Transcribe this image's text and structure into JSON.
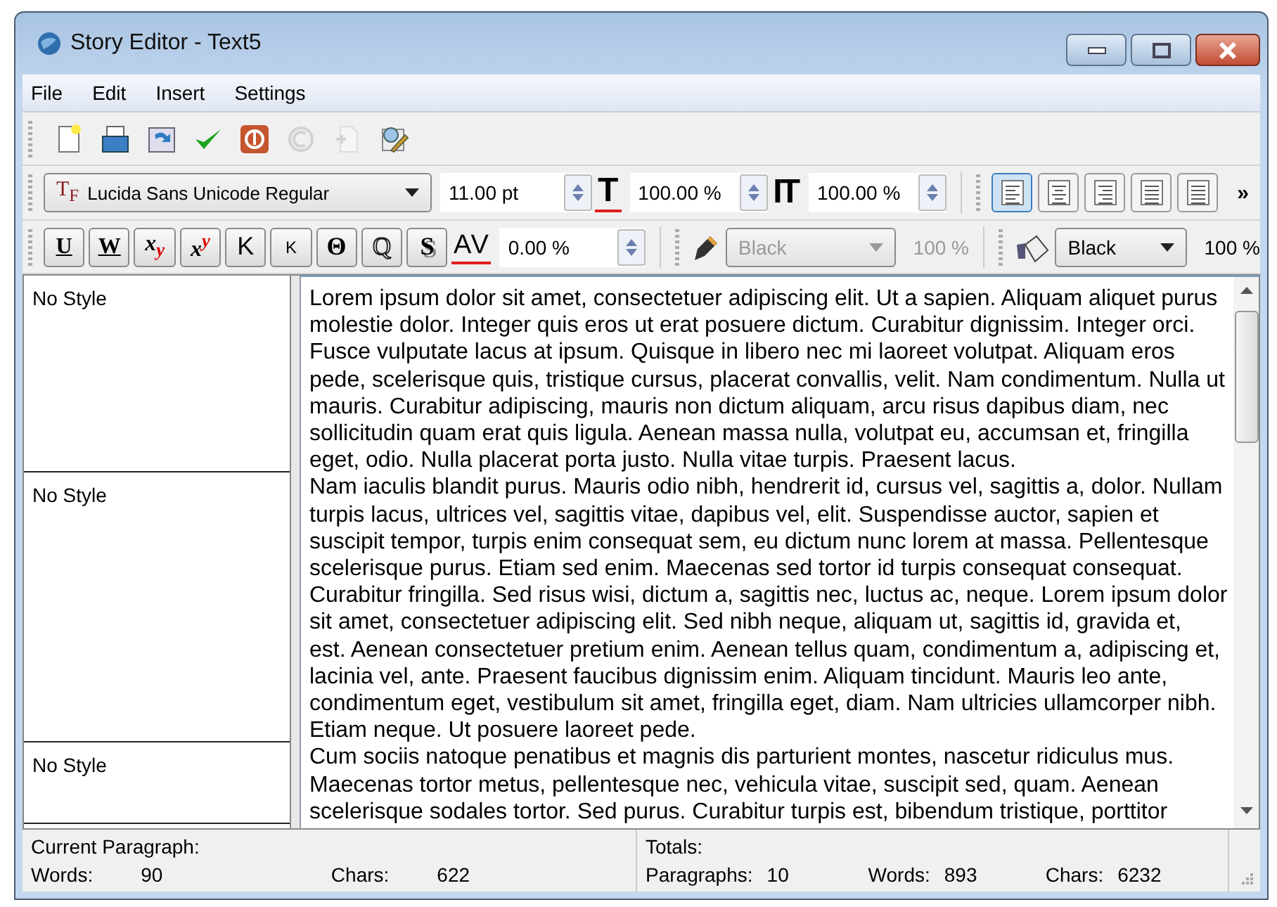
{
  "window": {
    "title": "Story Editor - Text5"
  },
  "menu": [
    "File",
    "Edit",
    "Insert",
    "Settings"
  ],
  "toolbar": [
    {
      "kind": "new",
      "disabled": false
    },
    {
      "kind": "open",
      "disabled": false
    },
    {
      "kind": "reload",
      "disabled": false
    },
    {
      "kind": "apply",
      "disabled": false
    },
    {
      "kind": "stop",
      "disabled": false
    },
    {
      "kind": "redo",
      "disabled": true
    },
    {
      "kind": "page",
      "disabled": true
    },
    {
      "kind": "edit",
      "disabled": false
    }
  ],
  "font_bar": {
    "font_icon": "T$_{F}$",
    "font": "Lucida Sans Unicode Regular",
    "size": "11.00 pt",
    "width_icon": "T",
    "width_scale": "100.00 %",
    "height_icon": "IT",
    "height_scale": "100.00 %",
    "alignments": [
      {
        "kind": "left",
        "selected": true
      },
      {
        "kind": "center",
        "selected": false
      },
      {
        "kind": "right",
        "selected": false
      },
      {
        "kind": "justify",
        "selected": false
      },
      {
        "kind": "full",
        "selected": false
      }
    ],
    "overflow": "»"
  },
  "style_bar": {
    "buttons": [
      {
        "kind": "underline",
        "label": "U"
      },
      {
        "kind": "underline",
        "label": "W"
      },
      {
        "kind": "script",
        "label": "x$_{y}$"
      },
      {
        "kind": "script",
        "label": "x$^{y}$"
      },
      {
        "kind": "caps",
        "label": "K"
      },
      {
        "kind": "smallcaps",
        "label": "K"
      },
      {
        "kind": "strike",
        "label": "Θ"
      },
      {
        "kind": "outline",
        "label": "Q"
      },
      {
        "kind": "shadow",
        "label": "S"
      }
    ],
    "kerning_icon": "AV",
    "kerning": "0.00 %",
    "stroke": {
      "color_name": "Black",
      "shade": "100 %",
      "disabled": true
    },
    "fill": {
      "color_name": "Black",
      "shade": "100 %",
      "disabled": false
    }
  },
  "paragraphs": [
    {
      "style": "No Style",
      "lines": [
        "Lorem ipsum dolor sit amet, consectetuer adipiscing elit. Ut a sapien. Aliquam aliquet purus",
        "molestie dolor. Integer quis eros ut erat posuere dictum. Curabitur dignissim. Integer orci.",
        "Fusce vulputate lacus at ipsum. Quisque in libero nec mi laoreet volutpat. Aliquam eros",
        "pede, scelerisque quis, tristique cursus, placerat convallis, velit. Nam condimentum. Nulla ut",
        "mauris. Curabitur adipiscing, mauris non dictum aliquam, arcu risus dapibus diam, nec",
        "sollicitudin quam erat quis ligula. Aenean massa nulla, volutpat eu, accumsan et, fringilla",
        "eget, odio. Nulla placerat porta justo. Nulla vitae turpis. Praesent lacus."
      ]
    },
    {
      "style": "No Style",
      "lines": [
        "Nam iaculis blandit purus. Mauris odio nibh, hendrerit id, cursus vel, sagittis a, dolor. Nullam",
        "turpis lacus, ultrices vel, sagittis vitae, dapibus vel, elit. Suspendisse auctor, sapien et",
        "suscipit tempor, turpis enim consequat sem, eu dictum nunc lorem at massa. Pellentesque",
        "scelerisque purus. Etiam sed enim. Maecenas sed tortor id turpis consequat consequat.",
        "Curabitur fringilla. Sed risus wisi, dictum a, sagittis nec, luctus ac, neque. Lorem ipsum dolor",
        "sit amet, consectetuer adipiscing elit. Sed nibh neque, aliquam ut, sagittis id, gravida et,",
        "est. Aenean consectetuer pretium enim. Aenean tellus quam, condimentum a, adipiscing et,",
        "lacinia vel, ante. Praesent faucibus dignissim enim. Aliquam tincidunt. Mauris leo ante,",
        "condimentum eget, vestibulum sit amet, fringilla eget, diam. Nam ultricies ullamcorper nibh.",
        "Etiam neque. Ut posuere laoreet pede."
      ]
    },
    {
      "style": "No Style",
      "lines": [
        "Cum sociis natoque penatibus et magnis dis parturient montes, nascetur ridiculus mus.",
        "Maecenas tortor metus, pellentesque nec, vehicula vitae, suscipit sed, quam. Aenean",
        "scelerisque sodales tortor. Sed purus. Curabitur turpis est, bibendum tristique, porttitor"
      ]
    }
  ],
  "status": {
    "current_title": "Current Paragraph:",
    "current": [
      {
        "label": "Words:",
        "value": "90"
      },
      {
        "label": "Chars:",
        "value": "622"
      }
    ],
    "totals_title": "Totals:",
    "totals": [
      {
        "label": "Paragraphs:",
        "value": "10"
      },
      {
        "label": "Words:",
        "value": "893"
      },
      {
        "label": "Chars:",
        "value": "6232"
      }
    ]
  }
}
